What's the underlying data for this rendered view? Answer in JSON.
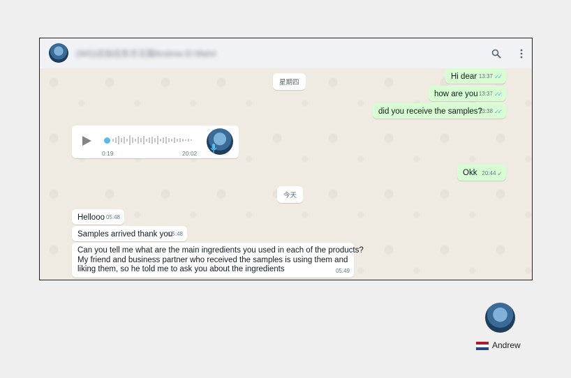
{
  "header": {
    "title": "(WG)达加达东方王国Andrew El Mahri",
    "search_icon": "search-icon",
    "menu_icon": "vertical-dots-icon"
  },
  "date_chips": {
    "first": "星期四",
    "second": "今天"
  },
  "messages_out": [
    {
      "text": "Hi dear",
      "time": "13:37",
      "status": "read"
    },
    {
      "text": "how are you",
      "time": "13:37",
      "status": "read"
    },
    {
      "text": "did you receive the samples?",
      "time": "13:38",
      "status": "read"
    },
    {
      "text": "Okk",
      "time": "20:44",
      "status": "delivered"
    }
  ],
  "voice_message": {
    "duration": "0:19",
    "time": "20:02",
    "progress": 0.0
  },
  "messages_in": [
    {
      "text": "Hellooo",
      "time": "05:48"
    },
    {
      "text": "Samples arrived thank you",
      "time": "05:48"
    },
    {
      "lines": [
        "Can you tell me what are the main ingredients you used in each of the products?",
        "My friend and business partner who received the samples is using them and",
        "liking them, so he told me to ask you about the ingredients"
      ],
      "time": "05:49"
    }
  ],
  "agent": {
    "name": "Andrew",
    "flag": "netherlands-flag"
  },
  "colors": {
    "outgoing": "#d9fdd3",
    "incoming": "#ffffff",
    "read_ticks": "#53bdeb",
    "header": "#f0f2f5",
    "wallpaper": "#efeae2"
  }
}
